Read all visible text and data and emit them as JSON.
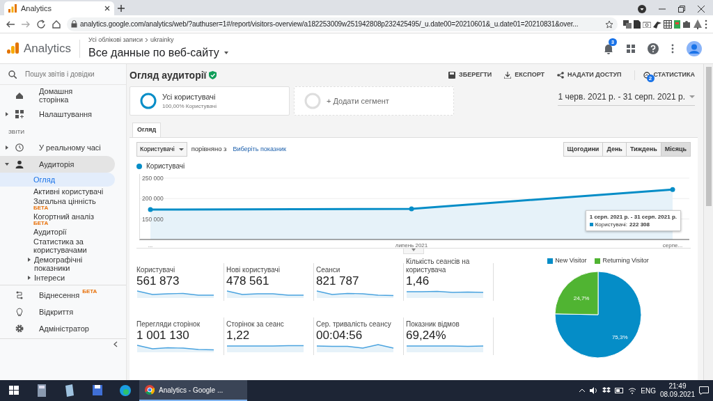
{
  "browser": {
    "tab_title": "Analytics",
    "url": "analytics.google.com/analytics/web/?authuser=1#/report/visitors-overview/a182253009w251942808p232425495/_u.date00=20210601&_u.date01=20210831&over..."
  },
  "header": {
    "app_name": "Analytics",
    "breadcrumb": [
      "Усі облікові записи",
      "ukrainky"
    ],
    "view": "Все данные по веб-сайту",
    "notifications": "3"
  },
  "sidebar": {
    "search_placeholder": "Пошук звітів і довідки",
    "items": [
      {
        "kind": "link",
        "label": "Домашня сторінка"
      },
      {
        "kind": "group",
        "label": "Налаштування",
        "expanded": false
      }
    ],
    "section": "ЗВІТИ",
    "reports": [
      {
        "kind": "group",
        "label": "У реальному часі",
        "expanded": false,
        "selected": false
      },
      {
        "kind": "group",
        "label": "Аудиторія",
        "expanded": true,
        "selected": true,
        "children": [
          {
            "kind": "link",
            "label": "Огляд",
            "selected": true
          },
          {
            "kind": "link",
            "label": "Активні користувачі",
            "selected": false
          },
          {
            "kind": "link",
            "label": "Загальна цінність",
            "beta": "БЕТА",
            "selected": false
          },
          {
            "kind": "link",
            "label": "Когортний аналіз",
            "beta": "БЕТА",
            "selected": false
          },
          {
            "kind": "link",
            "label": "Аудиторії",
            "selected": false
          },
          {
            "kind": "link",
            "label": "Статистика за користувачами",
            "selected": false
          },
          {
            "kind": "group",
            "label": "Демографічні показники",
            "expanded": false,
            "selected": false
          },
          {
            "kind": "group",
            "label": "Інтереси",
            "expanded": false,
            "selected": false
          }
        ]
      }
    ],
    "bottom": [
      {
        "label": "Віднесення",
        "beta": "БЕТА"
      },
      {
        "label": "Відкриття"
      },
      {
        "label": "Адміністратор"
      }
    ]
  },
  "main": {
    "title": "Огляд аудиторії",
    "verified": true,
    "actions": [
      {
        "label": "ЗБЕРЕГТИ"
      },
      {
        "label": "ЕКСПОРТ"
      },
      {
        "label": "НАДАТИ ДОСТУП"
      },
      {
        "label": "СТАТИСТИКА",
        "badge": "2"
      }
    ],
    "segments": [
      {
        "name": "Усі користувачі",
        "detail": "100,00% Користувачі"
      }
    ],
    "add_segment": "+ Додати сегмент",
    "date_range": "1 черв. 2021 р. - 31 серп. 2021 р.",
    "tabs": [
      {
        "label": "Огляд",
        "selected": true
      }
    ],
    "metric_select": "Користувачі",
    "compare_text": "порівняно з",
    "compare_link": "Виберіть показник",
    "granularity": [
      {
        "label": "Щогодини",
        "selected": false
      },
      {
        "label": "День",
        "selected": false
      },
      {
        "label": "Тиждень",
        "selected": false
      },
      {
        "label": "Місяць",
        "selected": true
      }
    ],
    "chart_data": {
      "type": "area",
      "grid": true,
      "x": [
        "...",
        "липень 2021",
        "серпе..."
      ],
      "series": [
        {
          "name": "Користувачі",
          "color": "#058dc7",
          "marker": true,
          "values": [
            173000,
            175000,
            222308
          ]
        }
      ],
      "ylim": [
        100000,
        260000
      ],
      "yticks": [
        {
          "value": 150000,
          "label": "150 000"
        },
        {
          "value": 200000,
          "label": "200 000"
        },
        {
          "value": 250000,
          "label": "250 000"
        }
      ]
    },
    "tooltip": {
      "title": "1 серп. 2021 р. - 31 серп. 2021 р.",
      "label": "Користувачі:",
      "value": "222 308"
    },
    "metrics": [
      {
        "label": "Користувачі",
        "value": "561 873"
      },
      {
        "label": "Нові користувачі",
        "value": "478 561"
      },
      {
        "label": "Сеанси",
        "value": "821 787"
      },
      {
        "label": "Кількість сеансів на користувача",
        "value": "1,46"
      },
      {
        "label": "Перегляди сторінок",
        "value": "1 001 130"
      },
      {
        "label": "Сторінок за сеанс",
        "value": "1,22"
      },
      {
        "label": "Сер. тривалість сеансу",
        "value": "00:04:56"
      },
      {
        "label": "Показник відмов",
        "value": "69,24%"
      }
    ],
    "pie": {
      "chart_data": {
        "type": "pie",
        "categories": [
          "New Visitor",
          "Returning Visitor"
        ],
        "colors": [
          "#058dc7",
          "#50b432"
        ],
        "values": [
          75.3,
          24.7
        ],
        "value_labels": [
          "75,3%",
          "24,7%"
        ],
        "legend": "top"
      }
    }
  },
  "taskbar": {
    "app": "Analytics - Google ...",
    "language": "ENG",
    "time": "21:49",
    "date": "08.09.2021"
  }
}
